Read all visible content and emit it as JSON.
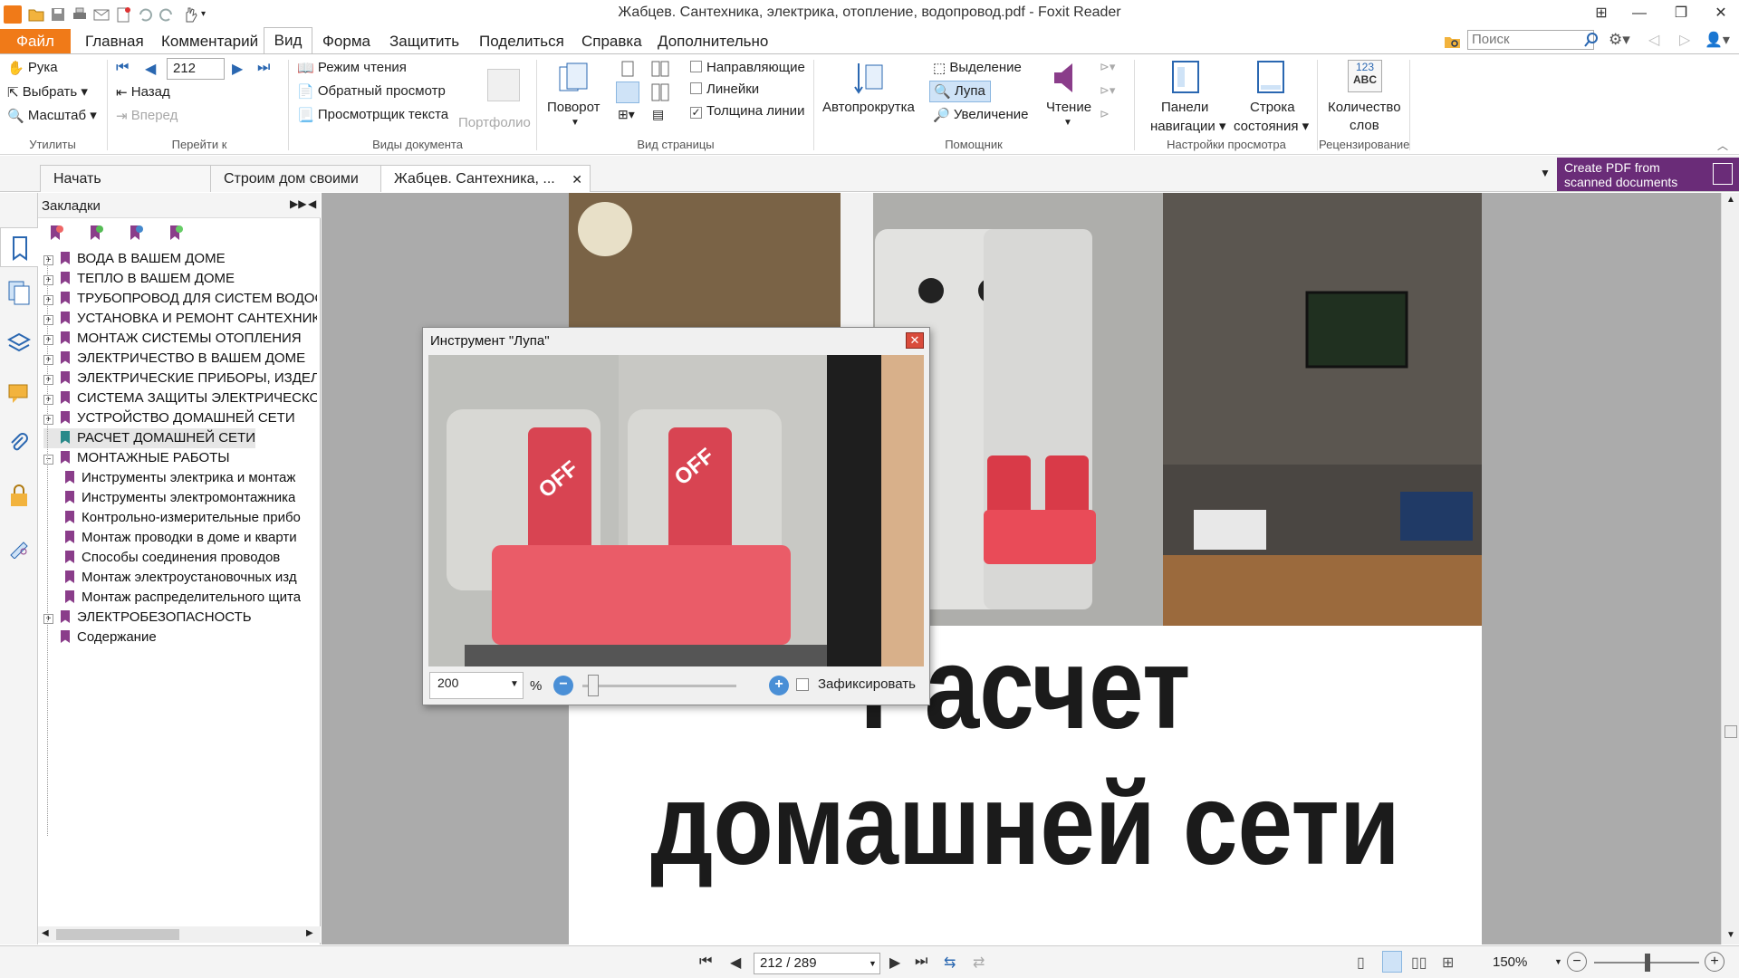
{
  "window": {
    "title": "Жабцев. Сантехника, электрика, отопление, водопровод.pdf - Foxit Reader",
    "buttons": [
      "restore-ribbon",
      "minimize",
      "maximize",
      "close"
    ]
  },
  "menu": {
    "items": [
      "Файл",
      "Главная",
      "Комментарий",
      "Вид",
      "Форма",
      "Защитить",
      "Поделиться",
      "Справка",
      "Дополнительно"
    ],
    "active": "Вид",
    "search_placeholder": "Поиск"
  },
  "ribbon": {
    "utilities": {
      "hand": "Рука",
      "select": "Выбрать",
      "zoom": "Масштаб",
      "label": "Утилиты"
    },
    "goto": {
      "page_value": "212",
      "back": "Назад",
      "forward": "Вперед",
      "label": "Перейти к"
    },
    "doc_views": {
      "reading_mode": "Режим чтения",
      "reverse_view": "Обратный просмотр",
      "text_viewer": "Просмотрщик текста",
      "portfolio": "Портфолио",
      "label": "Виды документа"
    },
    "page_view": {
      "rotate": "Поворот",
      "guides": "Направляющие",
      "rulers": "Линейки",
      "line_weights": "Толщина линии",
      "label": "Вид страницы"
    },
    "assistant": {
      "autoscroll": "Автопрокрутка",
      "selection": "Выделение",
      "loupe": "Лупа",
      "magnifier": "Увеличение",
      "read": "Чтение",
      "label": "Помощник"
    },
    "view_settings": {
      "nav_panels_1": "Панели",
      "nav_panels_2": "навигации",
      "status_bar_1": "Строка",
      "status_bar_2": "состояния",
      "label": "Настройки просмотра"
    },
    "review": {
      "icon_text_1": "123",
      "icon_text_2": "ABC",
      "word_count_1": "Количество",
      "word_count_2": "слов",
      "label": "Рецензирование"
    }
  },
  "tabs": [
    "Начать",
    "Строим дом своими р...",
    "Жабцев. Сантехника, ..."
  ],
  "promo": {
    "line1": "Create PDF from",
    "line2": "scanned documents"
  },
  "bookmarks": {
    "header": "Закладки",
    "items": [
      {
        "label": "ВОДА В ВАШЕМ ДОМЕ",
        "level": 0,
        "expander": "+"
      },
      {
        "label": "ТЕПЛО В ВАШЕМ ДОМЕ",
        "level": 0,
        "expander": "+"
      },
      {
        "label": "ТРУБОПРОВОД ДЛЯ СИСТЕМ ВОДОСН",
        "level": 0,
        "expander": "+"
      },
      {
        "label": "УСТАНОВКА И РЕМОНТ САНТЕХНИКИ",
        "level": 0,
        "expander": "+"
      },
      {
        "label": "МОНТАЖ СИСТЕМЫ ОТОПЛЕНИЯ",
        "level": 0,
        "expander": "+"
      },
      {
        "label": "ЭЛЕКТРИЧЕСТВО В ВАШЕМ ДОМЕ",
        "level": 0,
        "expander": "+"
      },
      {
        "label": "ЭЛЕКТРИЧЕСКИЕ ПРИБОРЫ, ИЗДЕЛИЯ",
        "level": 0,
        "expander": "+"
      },
      {
        "label": "СИСТЕМА ЗАЩИТЫ ЭЛЕКТРИЧЕСКОЙ",
        "level": 0,
        "expander": "+"
      },
      {
        "label": "УСТРОЙСТВО ДОМАШНЕЙ СЕТИ",
        "level": 0,
        "expander": "+"
      },
      {
        "label": "РАСЧЕТ ДОМАШНЕЙ СЕТИ",
        "level": 0,
        "expander": "",
        "selected": true
      },
      {
        "label": "МОНТАЖНЫЕ РАБОТЫ",
        "level": 0,
        "expander": "−"
      },
      {
        "label": "Инструменты электрика и монтаж",
        "level": 1,
        "expander": ""
      },
      {
        "label": "Инструменты электромонтажника",
        "level": 1,
        "expander": ""
      },
      {
        "label": "Контрольно-измерительные прибо",
        "level": 1,
        "expander": ""
      },
      {
        "label": "Монтаж проводки в доме и кварти",
        "level": 1,
        "expander": ""
      },
      {
        "label": "Способы соединения проводов",
        "level": 1,
        "expander": ""
      },
      {
        "label": "Монтаж электроустановочных изд",
        "level": 1,
        "expander": ""
      },
      {
        "label": "Монтаж распределительного щита",
        "level": 1,
        "expander": ""
      },
      {
        "label": "ЭЛЕКТРОБЕЗОПАСНОСТЬ",
        "level": 0,
        "expander": "+"
      },
      {
        "label": "Содержание",
        "level": 0,
        "expander": ""
      }
    ]
  },
  "page": {
    "heading_line1": "Расчет",
    "heading_line2": "домашней сети",
    "breaker_label": "OFF"
  },
  "loupe": {
    "title": "Инструмент \"Лупа\"",
    "zoom_value": "200",
    "percent": "%",
    "lock_label": "Зафиксировать",
    "lock_checked": false
  },
  "status": {
    "page_display": "212 / 289",
    "zoom": "150%"
  },
  "colors": {
    "file_tab": "#f07a18",
    "bookmark_flag": "#8a3d8a",
    "promo": "#6a2c78"
  }
}
